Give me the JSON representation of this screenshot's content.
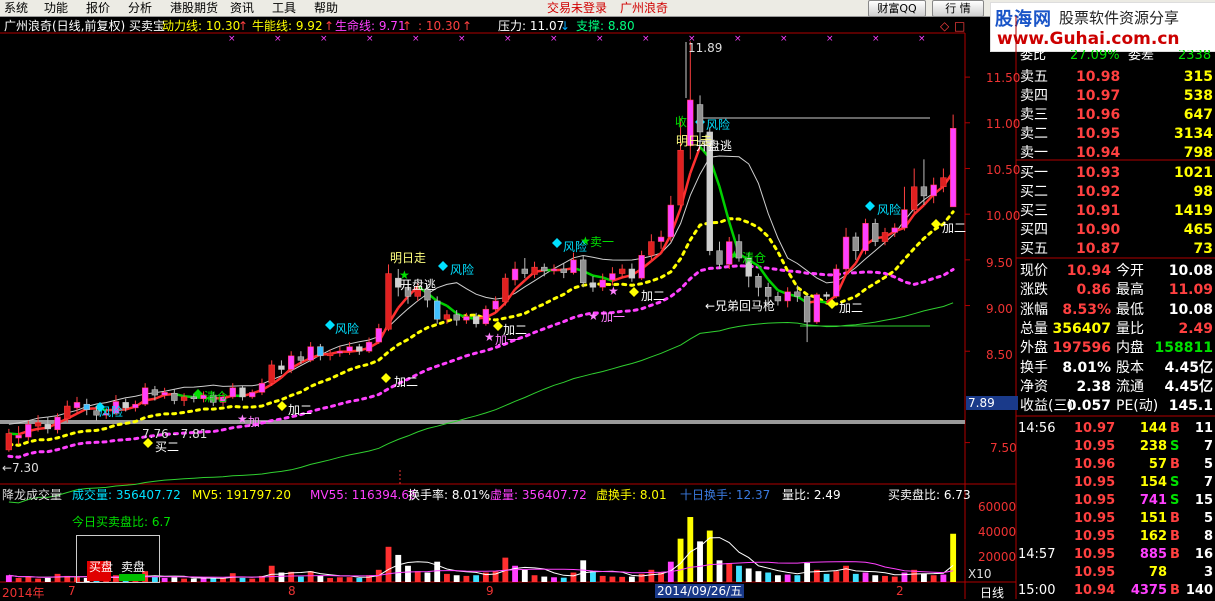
{
  "menu": [
    "系统",
    "功能",
    "报价",
    "分析",
    "港股期货",
    "资讯",
    "工具",
    "帮助"
  ],
  "status": {
    "login": "交易未登录",
    "broker": "广州浪奇"
  },
  "buttons": {
    "qq": "财富QQ",
    "quote": "行 情"
  },
  "logo": {
    "brand": "股海网",
    "slogan": "股票软件资源分享",
    "url": "www.Guhai.com.cn"
  },
  "header": {
    "title": "广州浪奇(日线,前复权) 买卖宝",
    "dongli": "动力线: 10.30",
    "niuneng": "牛能线: 9.92",
    "shengming": "生命线: 9.71",
    "extra": ": 10.30",
    "pressure": "压力: 11.07",
    "support": "支撑: 8.80"
  },
  "price_axis": [
    "11.50",
    "11.00",
    "10.50",
    "10.00",
    "9.50",
    "9.00",
    "8.50",
    "7.89",
    "7.50"
  ],
  "vol_axis": [
    "60000",
    "40000",
    "20000",
    "X10"
  ],
  "date_axis": {
    "year": "2014年",
    "m7": "7",
    "m8": "8",
    "m9": "9",
    "m2": "2",
    "cursor": "2014/09/26/五",
    "period": "日线"
  },
  "chart_annotations": {
    "high": "11.89",
    "low": "←7.30",
    "range": "7.76 - 7.81",
    "mingrizou": "明日走",
    "kaipantao": "开盘逃",
    "fengxian": "风险",
    "qingcang": "清仓",
    "jiaer": "加二",
    "jiayi": "加一",
    "mai": "卖",
    "maiyi": "卖一",
    "maier": "买二",
    "xiongdi": "←兄弟回马枪",
    "shou": "收"
  },
  "vol_header": {
    "name": "降龙成交量",
    "vol": "成交量: 356407.72",
    "mv5": "MV5: 191797.20",
    "mv55": "MV55: 116394.66",
    "turnover": "换手率: 8.01%",
    "xuliang": "虚量: 356407.72",
    "xuhuanshou": "虚换手: 8.01",
    "tenday": "十日换手: 12.37",
    "liangbi": "量比: 2.49",
    "maimaipanbi": "买卖盘比: 6.73",
    "today": "今日买卖盘比: 6.7",
    "buy": "买盘",
    "sell": "卖盘"
  },
  "orderbook": {
    "webi": {
      "label": "委比",
      "value": "27.09%",
      "label2": "委差",
      "value2": "2338"
    },
    "asks": [
      {
        "label": "卖五",
        "price": "10.98",
        "vol": "315"
      },
      {
        "label": "卖四",
        "price": "10.97",
        "vol": "538"
      },
      {
        "label": "卖三",
        "price": "10.96",
        "vol": "647"
      },
      {
        "label": "卖二",
        "price": "10.95",
        "vol": "3134"
      },
      {
        "label": "卖一",
        "price": "10.94",
        "vol": "798"
      }
    ],
    "bids": [
      {
        "label": "买一",
        "price": "10.93",
        "vol": "1021"
      },
      {
        "label": "买二",
        "price": "10.92",
        "vol": "98"
      },
      {
        "label": "买三",
        "price": "10.91",
        "vol": "1419"
      },
      {
        "label": "买四",
        "price": "10.90",
        "vol": "465"
      },
      {
        "label": "买五",
        "price": "10.87",
        "vol": "73"
      }
    ]
  },
  "stats": [
    {
      "l1": "现价",
      "v1": "10.94",
      "l2": "今开",
      "v2": "10.08",
      "c1": "#ff4040",
      "c2": "#ffffff"
    },
    {
      "l1": "涨跌",
      "v1": "0.86",
      "l2": "最高",
      "v2": "11.09",
      "c1": "#ff4040",
      "c2": "#ff4040"
    },
    {
      "l1": "涨幅",
      "v1": "8.53%",
      "l2": "最低",
      "v2": "10.08",
      "c1": "#ff4040",
      "c2": "#ffffff"
    },
    {
      "l1": "总量",
      "v1": "356407",
      "l2": "量比",
      "v2": "2.49",
      "c1": "#ffff00",
      "c2": "#ff4040"
    },
    {
      "l1": "外盘",
      "v1": "197596",
      "l2": "内盘",
      "v2": "158811",
      "c1": "#ff4040",
      "c2": "#00e000"
    },
    {
      "l1": "换手",
      "v1": "8.01%",
      "l2": "股本",
      "v2": "4.45亿",
      "c1": "#ffffff",
      "c2": "#ffffff"
    },
    {
      "l1": "净资",
      "v1": "2.38",
      "l2": "流通",
      "v2": "4.45亿",
      "c1": "#ffffff",
      "c2": "#ffffff"
    },
    {
      "l1": "收益(三)",
      "v1": "0.057",
      "l2": "PE(动)",
      "v2": "145.1",
      "c1": "#ffffff",
      "c2": "#ffffff"
    }
  ],
  "ticks": [
    {
      "time": "14:56",
      "price": "10.97",
      "vol": "144",
      "side": "B",
      "n": "11",
      "vc": "#ffff00",
      "sc": "#ff4040"
    },
    {
      "time": "",
      "price": "10.95",
      "vol": "238",
      "side": "S",
      "n": "7",
      "vc": "#ffff00",
      "sc": "#00e000"
    },
    {
      "time": "",
      "price": "10.96",
      "vol": "57",
      "side": "B",
      "n": "5",
      "vc": "#ffff00",
      "sc": "#ff4040"
    },
    {
      "time": "",
      "price": "10.95",
      "vol": "154",
      "side": "S",
      "n": "7",
      "vc": "#ffff00",
      "sc": "#00e000"
    },
    {
      "time": "",
      "price": "10.95",
      "vol": "741",
      "side": "S",
      "n": "15",
      "vc": "#ff40ff",
      "sc": "#00e000"
    },
    {
      "time": "",
      "price": "10.95",
      "vol": "151",
      "side": "B",
      "n": "5",
      "vc": "#ffff00",
      "sc": "#ff4040"
    },
    {
      "time": "",
      "price": "10.95",
      "vol": "162",
      "side": "B",
      "n": "8",
      "vc": "#ffff00",
      "sc": "#ff4040"
    },
    {
      "time": "14:57",
      "price": "10.95",
      "vol": "885",
      "side": "B",
      "n": "16",
      "vc": "#ff40ff",
      "sc": "#ff4040"
    },
    {
      "time": "",
      "price": "10.95",
      "vol": "78",
      "side": "",
      "n": "3",
      "vc": "#ffff00",
      "sc": "#ff4040"
    },
    {
      "time": "15:00",
      "price": "10.94",
      "vol": "4375",
      "side": "B",
      "n": "140",
      "vc": "#ff40ff",
      "sc": "#ff4040"
    }
  ],
  "chart_data": {
    "type": "candlestick",
    "candles": [
      [
        7.42,
        7.6,
        7.4,
        7.65
      ],
      [
        7.55,
        7.58,
        7.48,
        7.68
      ],
      [
        7.56,
        7.7,
        7.52,
        7.74
      ],
      [
        7.68,
        7.72,
        7.62,
        7.8
      ],
      [
        7.7,
        7.65,
        7.6,
        7.78
      ],
      [
        7.64,
        7.78,
        7.6,
        7.82
      ],
      [
        7.76,
        7.9,
        7.72,
        7.96
      ],
      [
        7.88,
        7.94,
        7.82,
        8.0
      ],
      [
        7.92,
        7.86,
        7.8,
        7.98
      ],
      [
        7.85,
        7.8,
        7.74,
        7.9
      ],
      [
        7.8,
        7.82,
        7.76,
        7.86
      ],
      [
        7.82,
        7.95,
        7.8,
        8.02
      ],
      [
        7.94,
        7.88,
        7.84,
        7.98
      ],
      [
        7.88,
        7.92,
        7.84,
        7.96
      ],
      [
        7.92,
        8.1,
        7.9,
        8.15
      ],
      [
        8.08,
        8.02,
        7.96,
        8.12
      ],
      [
        8.02,
        8.05,
        7.98,
        8.1
      ],
      [
        8.04,
        7.96,
        7.92,
        8.08
      ],
      [
        7.96,
        8.0,
        7.9,
        8.04
      ],
      [
        8.0,
        7.98,
        7.94,
        8.03
      ],
      [
        7.98,
        8.02,
        7.94,
        8.06
      ],
      [
        8.02,
        7.94,
        7.9,
        8.05
      ],
      [
        7.94,
        8.0,
        7.9,
        8.04
      ],
      [
        8.0,
        8.1,
        7.98,
        8.15
      ],
      [
        8.1,
        8.0,
        7.96,
        8.12
      ],
      [
        8.0,
        8.05,
        7.98,
        8.08
      ],
      [
        8.05,
        8.15,
        8.02,
        8.2
      ],
      [
        8.15,
        8.35,
        8.12,
        8.4
      ],
      [
        8.34,
        8.3,
        8.25,
        8.4
      ],
      [
        8.3,
        8.45,
        8.26,
        8.5
      ],
      [
        8.44,
        8.4,
        8.36,
        8.5
      ],
      [
        8.4,
        8.55,
        8.38,
        8.6
      ],
      [
        8.55,
        8.45,
        8.4,
        8.58
      ],
      [
        8.45,
        8.48,
        8.4,
        8.52
      ],
      [
        8.48,
        8.5,
        8.44,
        8.55
      ],
      [
        8.5,
        8.55,
        8.46,
        8.6
      ],
      [
        8.55,
        8.5,
        8.46,
        8.58
      ],
      [
        8.5,
        8.6,
        8.48,
        8.65
      ],
      [
        8.6,
        8.75,
        8.58,
        8.8
      ],
      [
        8.74,
        9.35,
        8.72,
        9.45
      ],
      [
        9.3,
        9.2,
        9.1,
        9.4
      ],
      [
        9.2,
        9.1,
        9.02,
        9.28
      ],
      [
        9.1,
        9.18,
        9.05,
        9.25
      ],
      [
        9.18,
        9.06,
        8.98,
        9.22
      ],
      [
        9.05,
        8.85,
        8.8,
        9.1
      ],
      [
        8.85,
        8.9,
        8.8,
        8.95
      ],
      [
        8.9,
        8.84,
        8.78,
        8.95
      ],
      [
        8.84,
        8.88,
        8.8,
        8.92
      ],
      [
        8.88,
        8.8,
        8.76,
        8.92
      ],
      [
        8.8,
        8.96,
        8.78,
        9.0
      ],
      [
        8.96,
        9.05,
        8.92,
        9.1
      ],
      [
        9.04,
        9.3,
        9.0,
        9.35
      ],
      [
        9.28,
        9.4,
        9.22,
        9.48
      ],
      [
        9.4,
        9.35,
        9.3,
        9.52
      ],
      [
        9.34,
        9.42,
        9.3,
        9.48
      ],
      [
        9.42,
        9.38,
        9.32,
        9.46
      ],
      [
        9.38,
        9.4,
        9.34,
        9.45
      ],
      [
        9.4,
        9.36,
        9.3,
        9.46
      ],
      [
        9.36,
        9.5,
        9.34,
        9.58
      ],
      [
        9.5,
        9.25,
        9.2,
        9.55
      ],
      [
        9.25,
        9.2,
        9.15,
        9.32
      ],
      [
        9.2,
        9.28,
        9.16,
        9.35
      ],
      [
        9.28,
        9.35,
        9.22,
        9.42
      ],
      [
        9.35,
        9.4,
        9.3,
        9.45
      ],
      [
        9.4,
        9.3,
        9.26,
        9.46
      ],
      [
        9.3,
        9.55,
        9.28,
        9.6
      ],
      [
        9.55,
        9.7,
        9.5,
        9.78
      ],
      [
        9.7,
        9.75,
        9.62,
        9.82
      ],
      [
        9.75,
        10.1,
        9.7,
        10.2
      ],
      [
        10.1,
        10.7,
        10.05,
        11.05
      ],
      [
        10.75,
        11.25,
        10.6,
        11.89
      ],
      [
        11.2,
        10.9,
        10.8,
        11.3
      ],
      [
        10.9,
        9.6,
        9.55,
        10.95
      ],
      [
        9.6,
        9.45,
        9.4,
        9.7
      ],
      [
        9.45,
        9.7,
        9.4,
        9.75
      ],
      [
        9.7,
        9.52,
        9.48,
        9.78
      ],
      [
        9.52,
        9.32,
        9.2,
        9.58
      ],
      [
        9.32,
        9.2,
        9.1,
        9.35
      ],
      [
        9.2,
        9.1,
        9.02,
        9.25
      ],
      [
        9.1,
        9.05,
        9.0,
        9.15
      ],
      [
        9.05,
        9.15,
        8.98,
        9.2
      ],
      [
        9.15,
        9.1,
        9.04,
        9.22
      ],
      [
        9.1,
        8.82,
        8.6,
        9.12
      ],
      [
        8.82,
        9.12,
        8.8,
        9.14
      ],
      [
        9.12,
        9.1,
        9.06,
        9.15
      ],
      [
        9.1,
        9.4,
        9.08,
        9.45
      ],
      [
        9.4,
        9.75,
        9.36,
        9.85
      ],
      [
        9.75,
        9.6,
        9.5,
        9.8
      ],
      [
        9.6,
        9.9,
        9.56,
        9.95
      ],
      [
        9.9,
        9.7,
        9.65,
        9.95
      ],
      [
        9.7,
        9.8,
        9.66,
        9.85
      ],
      [
        9.8,
        9.85,
        9.75,
        9.9
      ],
      [
        9.85,
        10.05,
        9.82,
        10.3
      ],
      [
        10.05,
        10.3,
        10.0,
        10.5
      ],
      [
        10.3,
        10.2,
        10.1,
        10.6
      ],
      [
        10.2,
        10.32,
        10.12,
        10.4
      ],
      [
        10.3,
        10.4,
        10.24,
        10.5
      ],
      [
        10.08,
        10.94,
        10.08,
        11.09
      ]
    ],
    "ylim": [
      7.2,
      11.95
    ],
    "series": [
      {
        "name": "动力线",
        "value": 10.3
      },
      {
        "name": "牛能线",
        "value": 9.92
      },
      {
        "name": "生命线",
        "value": 9.71
      }
    ],
    "volumes": [
      5000,
      3000,
      4000,
      2500,
      3000,
      6000,
      4500,
      3500,
      3000,
      3500,
      2000,
      5000,
      3000,
      3200,
      8000,
      4000,
      3000,
      3500,
      2500,
      2600,
      3000,
      2800,
      3000,
      6500,
      3000,
      2500,
      4500,
      12000,
      7000,
      7500,
      4000,
      8000,
      4500,
      3000,
      3500,
      3600,
      3000,
      5000,
      9000,
      26000,
      20000,
      12000,
      8000,
      7000,
      15000,
      6000,
      5000,
      4500,
      5000,
      7000,
      8000,
      18000,
      12000,
      9000,
      5000,
      4000,
      3500,
      3200,
      7000,
      16000,
      8000,
      4500,
      4000,
      3800,
      4000,
      6000,
      9000,
      7000,
      15000,
      32000,
      48000,
      30000,
      38000,
      16000,
      14000,
      12000,
      10000,
      8000,
      7000,
      5000,
      5500,
      5000,
      14000,
      9000,
      6000,
      8000,
      12000,
      6000,
      7000,
      5000,
      4500,
      4000,
      7000,
      9000,
      6000,
      5000,
      5500,
      35640
    ]
  }
}
